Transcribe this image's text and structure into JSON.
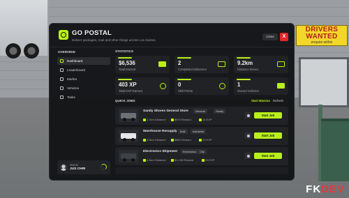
{
  "background": {
    "sign": {
      "line1": "DRIVERS",
      "line2": "WANTED",
      "line3": "enquire within"
    },
    "brand": {
      "part1": "FK",
      "part2": "DEV"
    }
  },
  "app": {
    "title": "GO POSTAL",
    "subtitle": "Deliver packages, mail and other things across Los Santos.",
    "close_label": "Close",
    "x_label": "X"
  },
  "sidebar": {
    "label": "OVERVIEW",
    "items": [
      {
        "label": "Dashboard",
        "active": true
      },
      {
        "label": "Leaderboard",
        "active": false
      },
      {
        "label": "Market",
        "active": false
      },
      {
        "label": "Vehicles",
        "active": false
      },
      {
        "label": "Tasks",
        "active": false
      }
    ],
    "owner": {
      "role": "Owner",
      "name": "JUS CHRI"
    }
  },
  "statistics": {
    "label": "STATISTICS",
    "cards": [
      {
        "value": "$6,536",
        "label": "Total Earned",
        "icon": "cash-icon"
      },
      {
        "value": "2",
        "label": "Completed Deliveries",
        "icon": "package-icon"
      },
      {
        "value": "9.2km",
        "label": "Distance Driven",
        "icon": "road-icon"
      },
      {
        "value": "403 XP",
        "label": "Total EXP Earned",
        "icon": "sparkle-icon"
      },
      {
        "value": "0",
        "label": "Skill Points",
        "icon": "trophy-icon"
      },
      {
        "value": "1",
        "label": "Owned Vehicles",
        "icon": "truck-icon"
      }
    ]
  },
  "jobs": {
    "label": "QUICK JOBS",
    "start_mission": "Start Mission",
    "refresh": "Refresh",
    "list": [
      {
        "name": "Sandy Shores General Store",
        "tags": [
          "General",
          "Sandy"
        ],
        "distance": "1.7km Distance",
        "reward": "$575 Reward",
        "exp": "14 EXP",
        "button": "Start Job"
      },
      {
        "name": "Warehouse Resupply",
        "tags": [
          "Bulk",
          "Industrial"
        ],
        "distance": "3.9km Distance",
        "reward": "$852 Reward",
        "exp": "22 EXP",
        "button": "Start Job"
      },
      {
        "name": "Electronics Shipment",
        "tags": [
          "Electronics",
          "City"
        ],
        "distance": "4.4km Distance",
        "reward": "$1,136 Reward",
        "exp": "29 EXP",
        "button": "Start Job"
      }
    ]
  }
}
